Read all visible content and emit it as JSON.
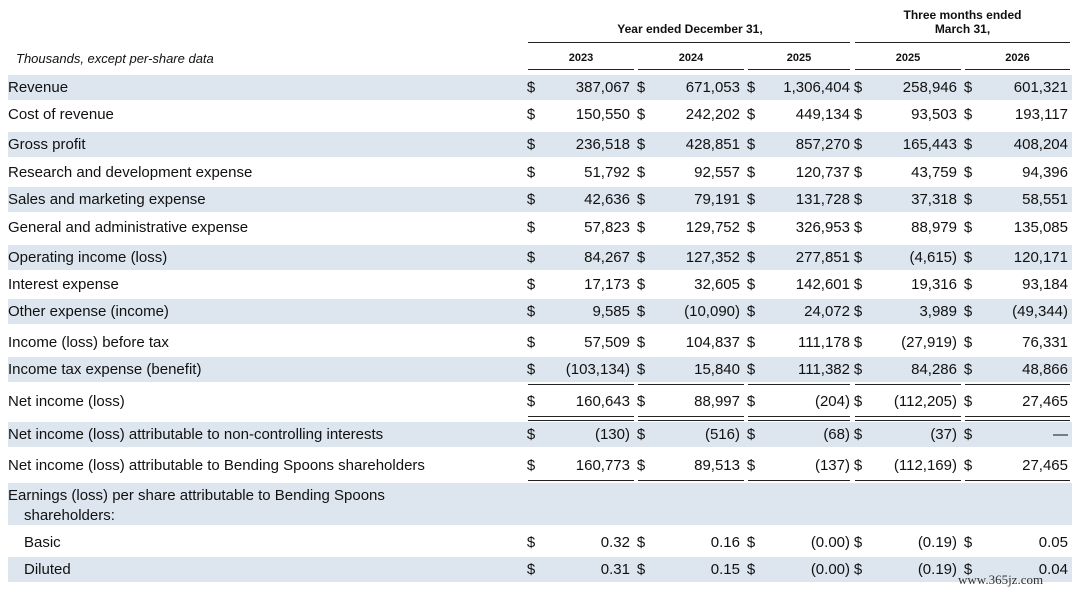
{
  "header": {
    "year_ended": "Year ended December 31,",
    "three_months_line1": "Three months ended",
    "three_months_line2": "March 31,",
    "units": "Thousands, except per-share data",
    "columns": [
      "2023",
      "2024",
      "2025",
      "2025",
      "2026"
    ]
  },
  "rows": [
    {
      "label": "Revenue",
      "values": [
        "387,067",
        "671,053",
        "1,306,404",
        "258,946",
        "601,321"
      ]
    },
    {
      "label": "Cost of revenue",
      "values": [
        "150,550",
        "242,202",
        "449,134",
        "93,503",
        "193,117"
      ]
    },
    {
      "label": "Gross profit",
      "values": [
        "236,518",
        "428,851",
        "857,270",
        "165,443",
        "408,204"
      ]
    },
    {
      "label": "Research and development expense",
      "values": [
        "51,792",
        "92,557",
        "120,737",
        "43,759",
        "94,396"
      ]
    },
    {
      "label": "Sales and marketing expense",
      "values": [
        "42,636",
        "79,191",
        "131,728",
        "37,318",
        "58,551"
      ]
    },
    {
      "label": "General and administrative expense",
      "values": [
        "57,823",
        "129,752",
        "326,953",
        "88,979",
        "135,085"
      ]
    },
    {
      "label": "Operating income (loss)",
      "values": [
        "84,267",
        "127,352",
        "277,851",
        "(4,615)",
        "120,171"
      ]
    },
    {
      "label": "Interest expense",
      "values": [
        "17,173",
        "32,605",
        "142,601",
        "19,316",
        "93,184"
      ]
    },
    {
      "label": "Other expense (income)",
      "values": [
        "9,585",
        "(10,090)",
        "24,072",
        "3,989",
        "(49,344)"
      ]
    },
    {
      "label": "Income (loss) before tax",
      "values": [
        "57,509",
        "104,837",
        "111,178",
        "(27,919)",
        "76,331"
      ]
    },
    {
      "label": "Income tax expense (benefit)",
      "values": [
        "(103,134)",
        "15,840",
        "111,382",
        "84,286",
        "48,866"
      ]
    },
    {
      "label": "Net income (loss)",
      "values": [
        "160,643",
        "88,997",
        "(204)",
        "(112,205)",
        "27,465"
      ]
    },
    {
      "label": "Net income (loss) attributable to non-controlling interests",
      "values": [
        "(130)",
        "(516)",
        "(68)",
        "(37)",
        "—"
      ]
    },
    {
      "label": "Net income (loss) attributable to Bending Spoons shareholders",
      "values": [
        "160,773",
        "89,513",
        "(137)",
        "(112,169)",
        "27,465"
      ]
    },
    {
      "label": "Earnings (loss) per share attributable to Bending Spoons",
      "label2": "shareholders:",
      "values": []
    },
    {
      "label": "Basic",
      "values": [
        "0.32",
        "0.16",
        "(0.00)",
        "(0.19)",
        "0.05"
      ]
    },
    {
      "label": "Diluted",
      "values": [
        "0.31",
        "0.15",
        "(0.00)",
        "(0.19)",
        "0.04"
      ]
    }
  ],
  "currency_symbol": "$",
  "watermark": "www.365jz.com"
}
